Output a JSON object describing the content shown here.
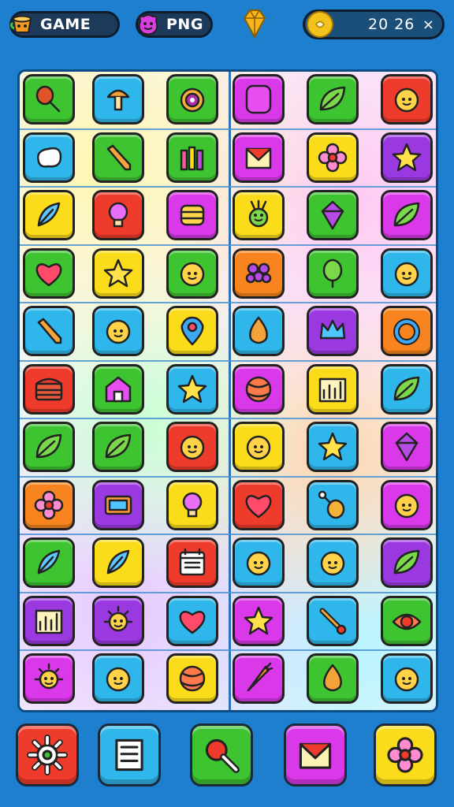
{
  "header": {
    "game_label": "GAME",
    "png_label": "PNG",
    "coins": "20 26",
    "close_glyph": "×"
  },
  "colors": {
    "background": "#1f7fcf",
    "green": "#3ec431",
    "blue": "#2fb6ea",
    "red": "#ef3b2c",
    "orange": "#f7841e",
    "yellow": "#fbdc1a",
    "magenta": "#d939e8",
    "purple": "#9b39e0",
    "pink": "#f23fb9"
  },
  "board": {
    "rows": [
      [
        {
          "color": "green",
          "icon": "maraca-icon"
        },
        {
          "color": "blue",
          "icon": "mushroom-icon"
        },
        {
          "color": "green",
          "icon": "clock-icon"
        },
        {
          "color": "magenta",
          "icon": "blank-icon"
        },
        {
          "color": "green",
          "icon": "leaf-icon"
        },
        {
          "color": "red",
          "icon": "smiley-icon"
        }
      ],
      [
        {
          "color": "blue",
          "icon": "cloud-icon"
        },
        {
          "color": "green",
          "icon": "pencil-icon"
        },
        {
          "color": "green",
          "icon": "bottles-icon"
        },
        {
          "color": "magenta",
          "icon": "envelope-icon"
        },
        {
          "color": "yellow",
          "icon": "flower-icon"
        },
        {
          "color": "purple",
          "icon": "star-icon"
        }
      ],
      [
        {
          "color": "yellow",
          "icon": "feather-icon"
        },
        {
          "color": "red",
          "icon": "bulb-icon"
        },
        {
          "color": "magenta",
          "icon": "drum-icon"
        },
        {
          "color": "yellow",
          "icon": "radish-icon"
        },
        {
          "color": "green",
          "icon": "gem-icon"
        },
        {
          "color": "magenta",
          "icon": "leaf-icon"
        }
      ],
      [
        {
          "color": "green",
          "icon": "heart-icon"
        },
        {
          "color": "yellow",
          "icon": "star-icon"
        },
        {
          "color": "green",
          "icon": "smiley-icon"
        },
        {
          "color": "orange",
          "icon": "grapes-icon"
        },
        {
          "color": "green",
          "icon": "balloon-icon"
        },
        {
          "color": "blue",
          "icon": "smiley-icon"
        }
      ],
      [
        {
          "color": "blue",
          "icon": "pencil-icon"
        },
        {
          "color": "blue",
          "icon": "smiley-icon"
        },
        {
          "color": "yellow",
          "icon": "pin-icon"
        },
        {
          "color": "blue",
          "icon": "drop-icon"
        },
        {
          "color": "purple",
          "icon": "crown-icon"
        },
        {
          "color": "orange",
          "icon": "ring-icon"
        }
      ],
      [
        {
          "color": "red",
          "icon": "chest-icon"
        },
        {
          "color": "green",
          "icon": "house-icon"
        },
        {
          "color": "blue",
          "icon": "star-icon"
        },
        {
          "color": "magenta",
          "icon": "ball-icon"
        },
        {
          "color": "yellow",
          "icon": "chart-icon"
        },
        {
          "color": "blue",
          "icon": "leaf-icon"
        }
      ],
      [
        {
          "color": "green",
          "icon": "leaf-icon"
        },
        {
          "color": "green",
          "icon": "leaf-icon"
        },
        {
          "color": "red",
          "icon": "smiley-icon"
        },
        {
          "color": "yellow",
          "icon": "smiley-icon"
        },
        {
          "color": "blue",
          "icon": "star-icon"
        },
        {
          "color": "magenta",
          "icon": "gem-icon"
        }
      ],
      [
        {
          "color": "orange",
          "icon": "flower-icon"
        },
        {
          "color": "purple",
          "icon": "panel-icon"
        },
        {
          "color": "yellow",
          "icon": "bulb-icon"
        },
        {
          "color": "red",
          "icon": "heart-icon"
        },
        {
          "color": "blue",
          "icon": "drumstick-icon"
        },
        {
          "color": "magenta",
          "icon": "smiley-icon"
        }
      ],
      [
        {
          "color": "green",
          "icon": "feather-icon"
        },
        {
          "color": "yellow",
          "icon": "feather-icon"
        },
        {
          "color": "red",
          "icon": "calendar-icon"
        },
        {
          "color": "blue",
          "icon": "smiley-icon"
        },
        {
          "color": "blue",
          "icon": "smiley-icon"
        },
        {
          "color": "purple",
          "icon": "leaf-icon"
        }
      ],
      [
        {
          "color": "purple",
          "icon": "chart-icon"
        },
        {
          "color": "purple",
          "icon": "sun-icon"
        },
        {
          "color": "blue",
          "icon": "heart-icon"
        },
        {
          "color": "magenta",
          "icon": "star-icon"
        },
        {
          "color": "blue",
          "icon": "brush-icon"
        },
        {
          "color": "green",
          "icon": "eye-icon"
        }
      ],
      [
        {
          "color": "magenta",
          "icon": "sun-icon"
        },
        {
          "color": "blue",
          "icon": "smiley-icon"
        },
        {
          "color": "yellow",
          "icon": "ball-icon"
        },
        {
          "color": "magenta",
          "icon": "carrot-icon"
        },
        {
          "color": "green",
          "icon": "drop-icon"
        },
        {
          "color": "blue",
          "icon": "smiley-icon"
        }
      ]
    ]
  },
  "toolbar": {
    "buttons": [
      {
        "name": "settings-button",
        "icon": "gear-icon",
        "color": "red"
      },
      {
        "name": "list-button",
        "icon": "list-icon",
        "color": "blue"
      },
      {
        "name": "search-button",
        "icon": "magnifier-icon",
        "color": "green"
      },
      {
        "name": "message-button",
        "icon": "envelope-icon",
        "color": "magenta"
      },
      {
        "name": "flower-button",
        "icon": "flower-icon",
        "color": "yellow"
      }
    ]
  }
}
